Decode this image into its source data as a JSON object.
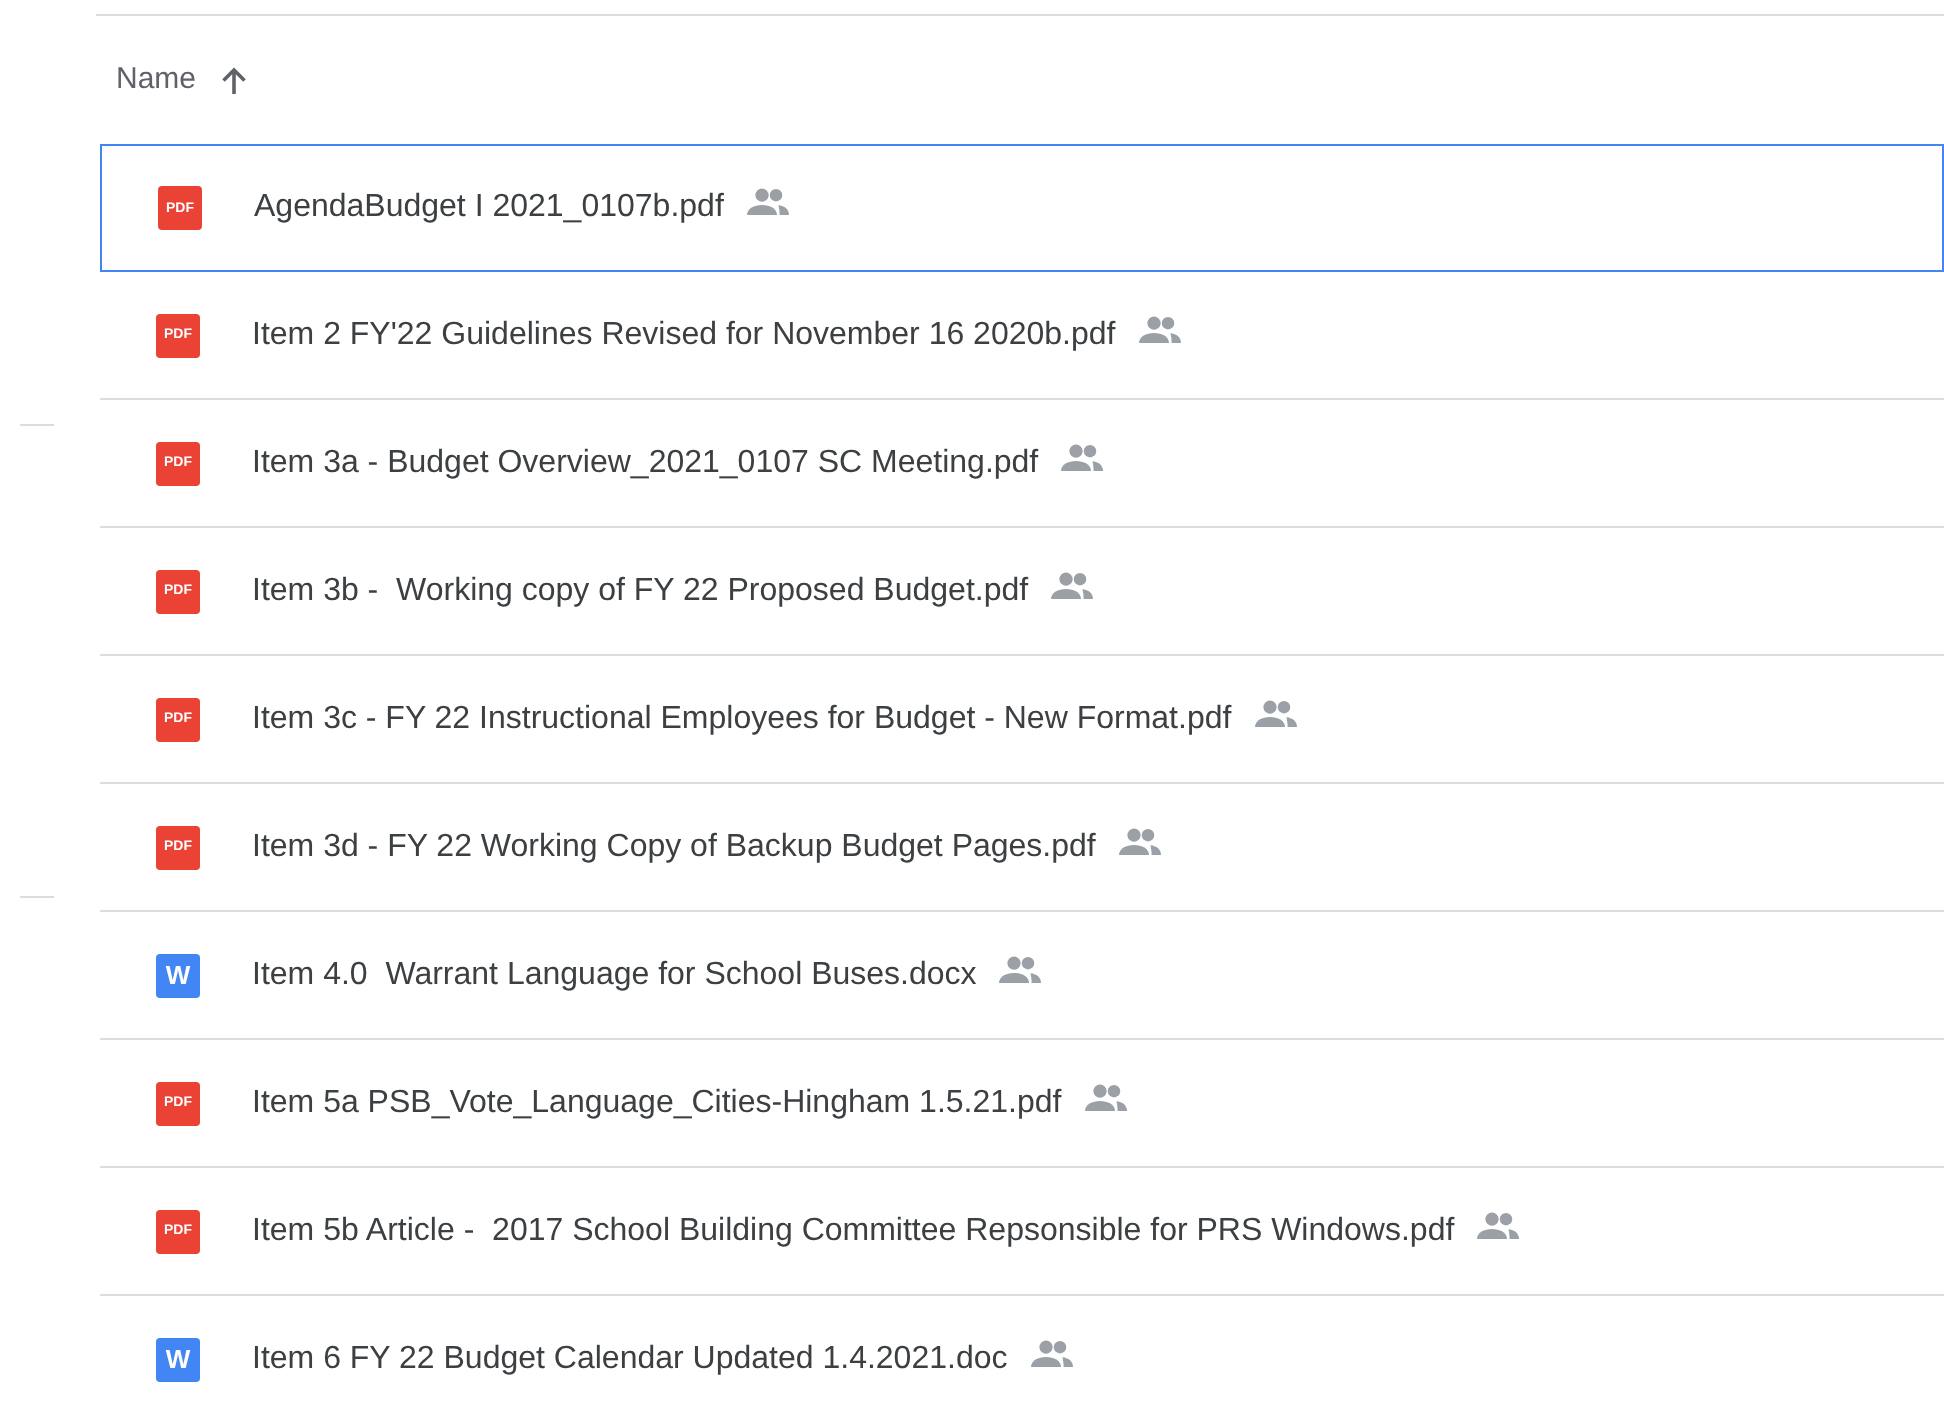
{
  "column_header": {
    "label": "Name",
    "ascending": true
  },
  "files": [
    {
      "name": "AgendaBudget I 2021_0107b.pdf",
      "kind": "pdf",
      "badge": "PDF",
      "shared": true,
      "selected": true
    },
    {
      "name": "Item 2 FY'22 Guidelines Revised for November 16 2020b.pdf",
      "kind": "pdf",
      "badge": "PDF",
      "shared": true,
      "selected": false
    },
    {
      "name": "Item 3a - Budget Overview_2021_0107 SC Meeting.pdf",
      "kind": "pdf",
      "badge": "PDF",
      "shared": true,
      "selected": false
    },
    {
      "name": "Item 3b -  Working copy of FY 22 Proposed Budget.pdf",
      "kind": "pdf",
      "badge": "PDF",
      "shared": true,
      "selected": false
    },
    {
      "name": "Item 3c - FY 22 Instructional Employees for Budget - New Format.pdf",
      "kind": "pdf",
      "badge": "PDF",
      "shared": true,
      "selected": false
    },
    {
      "name": "Item 3d - FY 22 Working Copy of Backup Budget Pages.pdf",
      "kind": "pdf",
      "badge": "PDF",
      "shared": true,
      "selected": false
    },
    {
      "name": "Item 4.0  Warrant Language for School Buses.docx",
      "kind": "word",
      "badge": "W",
      "shared": true,
      "selected": false
    },
    {
      "name": "Item 5a PSB_Vote_Language_Cities-Hingham 1.5.21.pdf",
      "kind": "pdf",
      "badge": "PDF",
      "shared": true,
      "selected": false
    },
    {
      "name": "Item 5b Article -  2017 School Building Committee Repsonsible for PRS Windows.pdf",
      "kind": "pdf",
      "badge": "PDF",
      "shared": true,
      "selected": false
    },
    {
      "name": "Item 6 FY 22 Budget Calendar Updated 1.4.2021.doc",
      "kind": "word",
      "badge": "W",
      "shared": true,
      "selected": false
    }
  ]
}
